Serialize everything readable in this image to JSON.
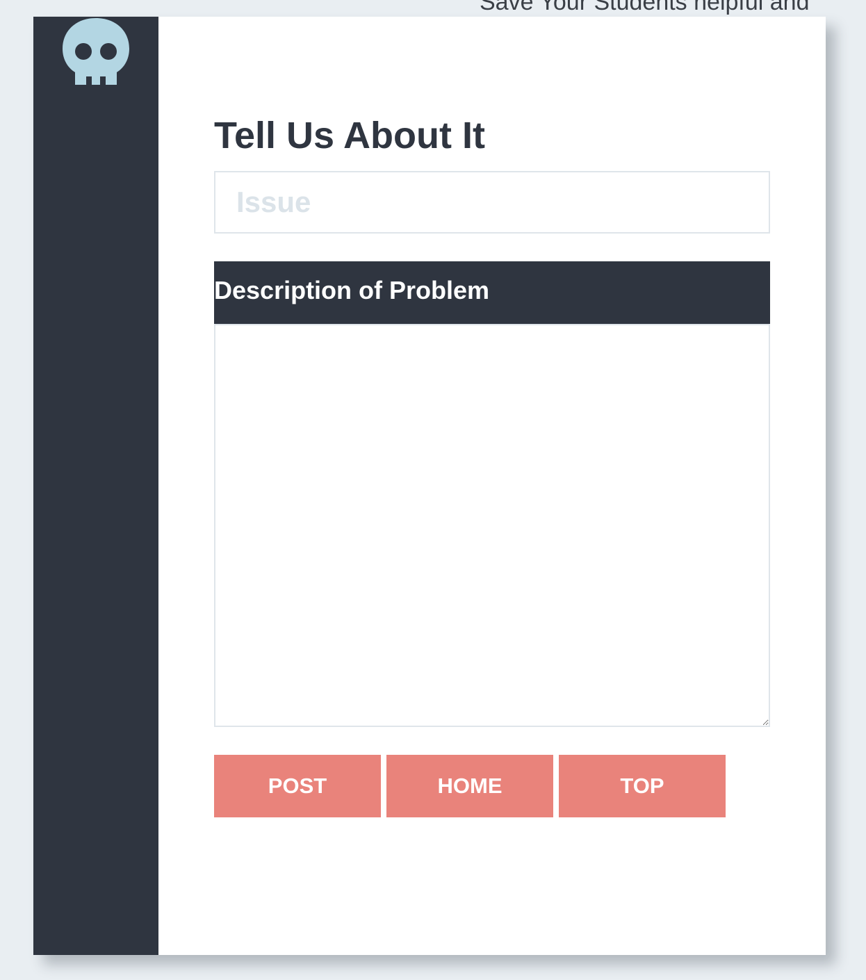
{
  "header": {
    "tagline": "Save Your Students helpful and"
  },
  "sidebar": {
    "logo_icon": "skull-icon",
    "logo_color": "#b3d6e3",
    "background": "#2f3540"
  },
  "form": {
    "title": "Tell Us About It",
    "issue_placeholder": "Issue",
    "issue_value": "",
    "description_label": "Description of Problem",
    "description_value": ""
  },
  "buttons": {
    "post": "POST",
    "home": "HOME",
    "top": "TOP",
    "color": "#e9837b"
  }
}
